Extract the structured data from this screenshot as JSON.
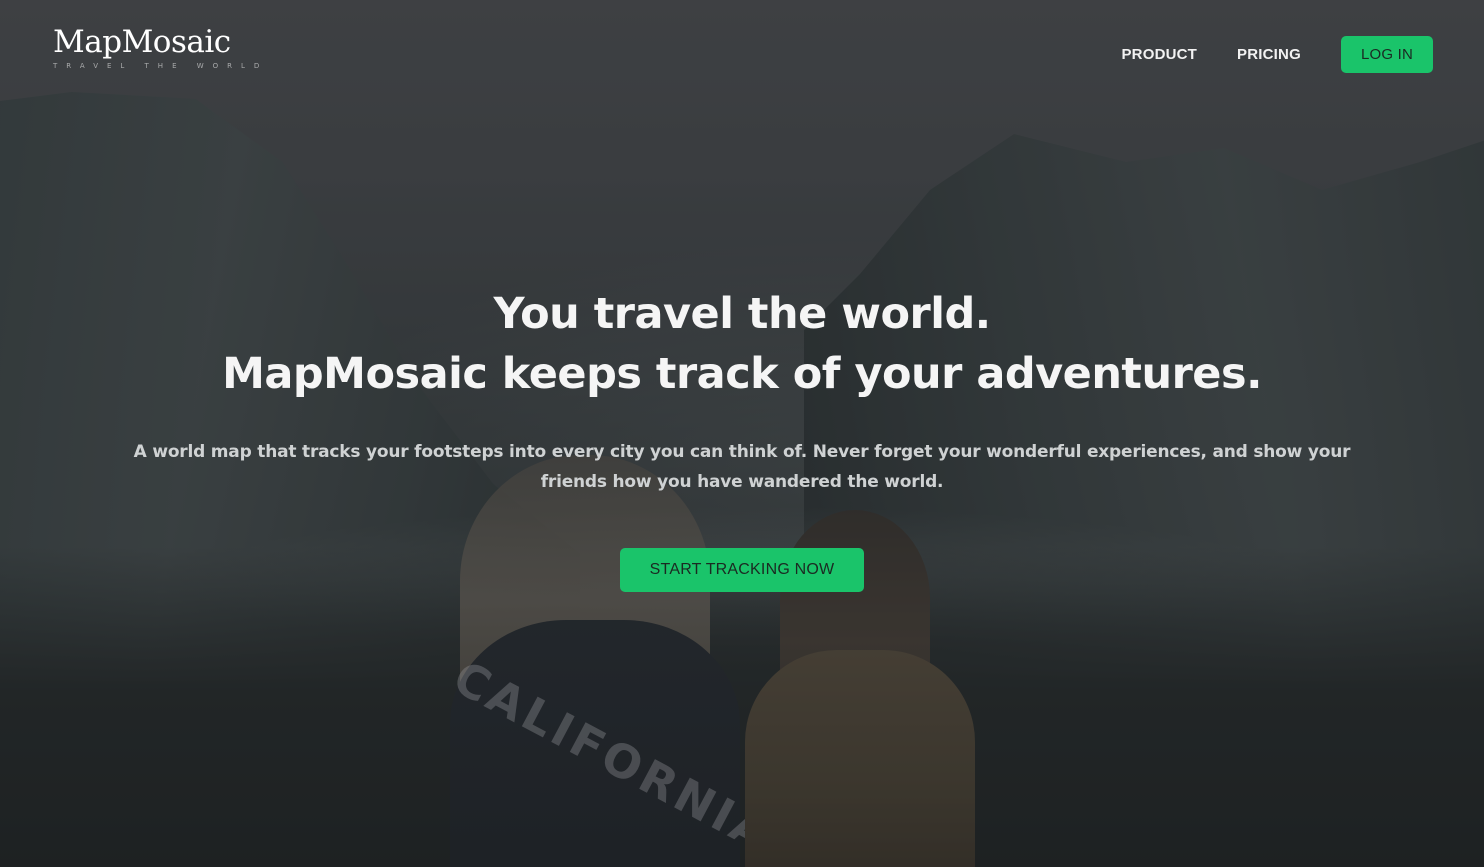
{
  "brand": {
    "name": "MapMosaic",
    "tagline": "TRAVEL THE WORLD"
  },
  "nav": {
    "items": [
      {
        "label": "PRODUCT"
      },
      {
        "label": "PRICING"
      }
    ],
    "login_label": "LOG IN"
  },
  "hero": {
    "title_line1": "You travel the world.",
    "title_line2": "MapMosaic keeps track of your adventures.",
    "subtitle": "A world map that tracks your footsteps into every city you can think of. Never forget your wonderful experiences, and show your friends how you have wandered the world.",
    "cta_label": "START TRACKING NOW"
  },
  "background": {
    "jersey_text": "CALIFORNIA"
  },
  "colors": {
    "accent": "#1ac46a",
    "text_light": "#f5f5f5"
  }
}
